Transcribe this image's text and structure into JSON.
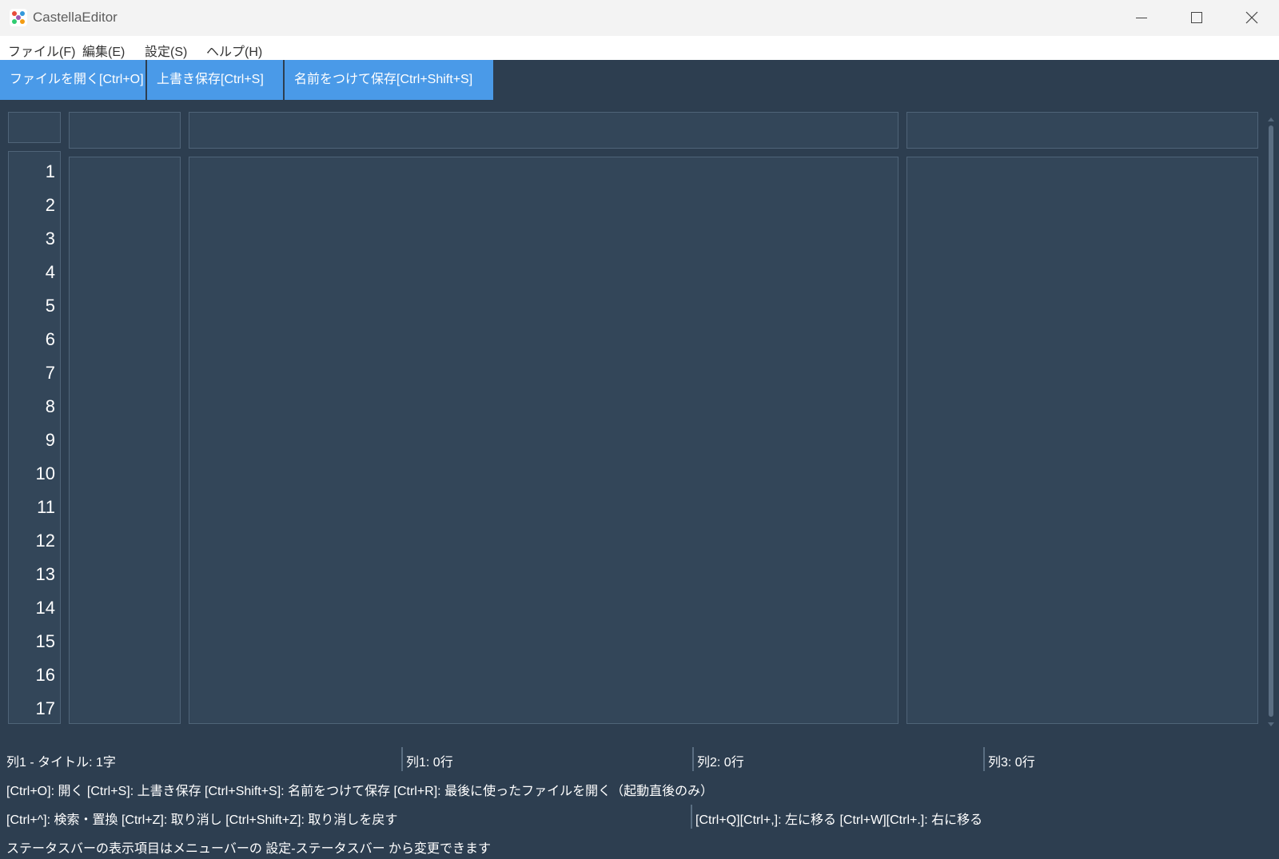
{
  "window": {
    "title": "CastellaEditor"
  },
  "menu": {
    "items": [
      "ファイル(F)",
      "編集(E)",
      "設定(S)",
      "ヘルプ(H)"
    ]
  },
  "toolbar": {
    "open": "ファイルを開く[Ctrl+O]",
    "save": "上書き保存[Ctrl+S]",
    "save_as": "名前をつけて保存[Ctrl+Shift+S]"
  },
  "editor": {
    "line_numbers": [
      "1",
      "2",
      "3",
      "4",
      "5",
      "6",
      "7",
      "8",
      "9",
      "10",
      "11",
      "12",
      "13",
      "14",
      "15",
      "16",
      "17"
    ]
  },
  "status": {
    "col1_title": "列1 - タイトル: 1字",
    "col1_lines": "列1: 0行",
    "col2_lines": "列2: 0行",
    "col3_lines": "列3: 0行",
    "shortcuts1": "[Ctrl+O]: 開く  [Ctrl+S]: 上書き保存  [Ctrl+Shift+S]: 名前をつけて保存  [Ctrl+R]: 最後に使ったファイルを開く（起動直後のみ）",
    "shortcuts2_left": "[Ctrl+^]: 検索・置換  [Ctrl+Z]: 取り消し  [Ctrl+Shift+Z]: 取り消しを戻す",
    "shortcuts2_right": "[Ctrl+Q][Ctrl+,]: 左に移る  [Ctrl+W][Ctrl+.]: 右に移る",
    "hint": "ステータスバーの表示項目はメニューバーの 設定-ステータスバー から変更できます"
  },
  "colors": {
    "background": "#2d3e50",
    "panel": "#334659",
    "accent": "#4a9ae8"
  }
}
